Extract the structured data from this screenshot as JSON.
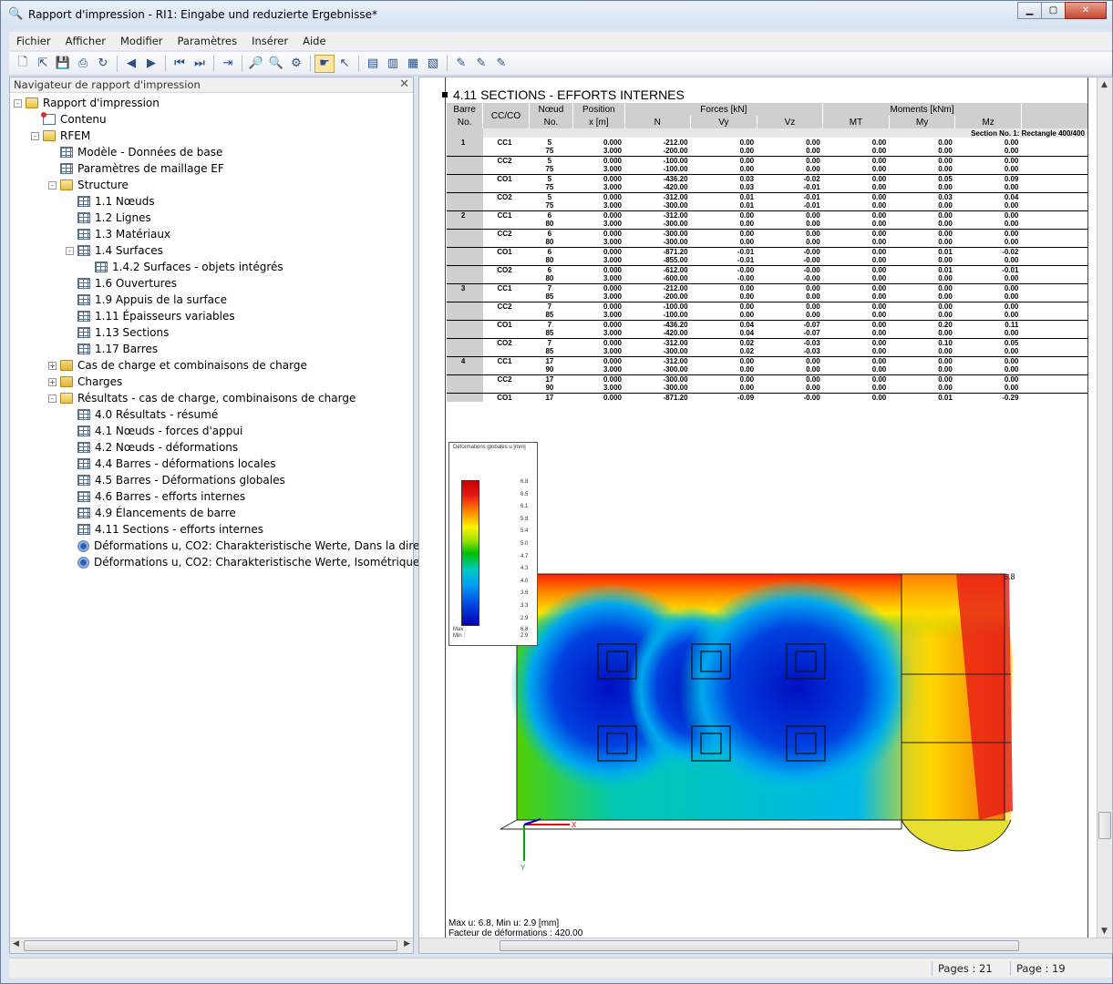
{
  "window": {
    "title": "Rapport d'impression - RI1: Eingabe und reduzierte Ergebnisse*"
  },
  "menu": [
    "Fichier",
    "Afficher",
    "Modifier",
    "Paramètres",
    "Insérer",
    "Aide"
  ],
  "navigator": {
    "header": "Navigateur de rapport d'impression",
    "items": [
      {
        "label": "Rapport d'impression",
        "level": 0,
        "icon": "folder-open",
        "exp": "-"
      },
      {
        "label": "Contenu",
        "level": 1,
        "icon": "contents",
        "exp": ""
      },
      {
        "label": "RFEM",
        "level": 1,
        "icon": "folder-open",
        "exp": "-"
      },
      {
        "label": "Modèle - Données de base",
        "level": 2,
        "icon": "table",
        "exp": ""
      },
      {
        "label": "Paramètres de maillage EF",
        "level": 2,
        "icon": "table",
        "exp": ""
      },
      {
        "label": "Structure",
        "level": 2,
        "icon": "folder-open",
        "exp": "-"
      },
      {
        "label": "1.1 Nœuds",
        "level": 3,
        "icon": "table",
        "exp": ""
      },
      {
        "label": "1.2 Lignes",
        "level": 3,
        "icon": "table",
        "exp": ""
      },
      {
        "label": "1.3 Matériaux",
        "level": 3,
        "icon": "table",
        "exp": ""
      },
      {
        "label": "1.4 Surfaces",
        "level": 3,
        "icon": "table",
        "exp": "-"
      },
      {
        "label": "1.4.2 Surfaces - objets intégrés",
        "level": 4,
        "icon": "table",
        "exp": ""
      },
      {
        "label": "1.6 Ouvertures",
        "level": 3,
        "icon": "table",
        "exp": ""
      },
      {
        "label": "1.9 Appuis de la surface",
        "level": 3,
        "icon": "table",
        "exp": ""
      },
      {
        "label": "1.11 Épaisseurs variables",
        "level": 3,
        "icon": "table",
        "exp": ""
      },
      {
        "label": "1.13 Sections",
        "level": 3,
        "icon": "table",
        "exp": ""
      },
      {
        "label": "1.17 Barres",
        "level": 3,
        "icon": "table",
        "exp": ""
      },
      {
        "label": "Cas de charge et combinaisons de charge",
        "level": 2,
        "icon": "folder",
        "exp": "+"
      },
      {
        "label": "Charges",
        "level": 2,
        "icon": "folder",
        "exp": "+"
      },
      {
        "label": "Résultats - cas de charge, combinaisons de charge",
        "level": 2,
        "icon": "folder-open",
        "exp": "-"
      },
      {
        "label": "4.0 Résultats - résumé",
        "level": 3,
        "icon": "table",
        "exp": ""
      },
      {
        "label": "4.1 Nœuds - forces d'appui",
        "level": 3,
        "icon": "table",
        "exp": ""
      },
      {
        "label": "4.2 Nœuds - déformations",
        "level": 3,
        "icon": "table",
        "exp": ""
      },
      {
        "label": "4.4 Barres - déformations locales",
        "level": 3,
        "icon": "table",
        "exp": ""
      },
      {
        "label": "4.5 Barres - Déformations globales",
        "level": 3,
        "icon": "table",
        "exp": ""
      },
      {
        "label": "4.6 Barres - efforts internes",
        "level": 3,
        "icon": "table",
        "exp": ""
      },
      {
        "label": "4.9 Élancements de barre",
        "level": 3,
        "icon": "table",
        "exp": ""
      },
      {
        "label": "4.11 Sections - efforts internes",
        "level": 3,
        "icon": "table",
        "exp": ""
      },
      {
        "label": "Déformations u, CO2: Charakteristische Werte, Dans la direction Z",
        "level": 3,
        "icon": "eye",
        "exp": ""
      },
      {
        "label": "Déformations u, CO2: Charakteristische Werte, Isométrique",
        "level": 3,
        "icon": "eye",
        "exp": ""
      }
    ]
  },
  "report": {
    "section_title": "4.11 SECTIONS - EFFORTS INTERNES",
    "headers": {
      "barre": "Barre",
      "barre_no": "No.",
      "cc": "CC/CO",
      "noeud": "Nœud",
      "noeud_no": "No.",
      "position": "Position",
      "position_unit": "x [m]",
      "forces": "Forces [kN]",
      "moments": "Moments [kNm]",
      "n": "N",
      "vy": "Vy",
      "vz": "Vz",
      "mt": "MT",
      "my": "My",
      "mz": "Mz"
    },
    "section_label": "Section No. 1: Rectangle 400/400",
    "rows": [
      [
        "1",
        "CC1",
        "5",
        "0.000",
        "-212.00",
        "0.00",
        "0.00",
        "0.00",
        "0.00",
        "0.00"
      ],
      [
        "",
        "",
        "75",
        "3.000",
        "-200.00",
        "0.00",
        "0.00",
        "0.00",
        "0.00",
        "0.00"
      ],
      [
        "",
        "CC2",
        "5",
        "0.000",
        "-100.00",
        "0.00",
        "0.00",
        "0.00",
        "0.00",
        "0.00"
      ],
      [
        "",
        "",
        "75",
        "3.000",
        "-100.00",
        "0.00",
        "0.00",
        "0.00",
        "0.00",
        "0.00"
      ],
      [
        "",
        "CO1",
        "5",
        "0.000",
        "-436.20",
        "0.03",
        "-0.02",
        "0.00",
        "0.05",
        "0.09"
      ],
      [
        "",
        "",
        "75",
        "3.000",
        "-420.00",
        "0.03",
        "-0.01",
        "0.00",
        "0.00",
        "0.00"
      ],
      [
        "",
        "CO2",
        "5",
        "0.000",
        "-312.00",
        "0.01",
        "-0.01",
        "0.00",
        "0.03",
        "0.04"
      ],
      [
        "",
        "",
        "75",
        "3.000",
        "-300.00",
        "0.01",
        "-0.01",
        "0.00",
        "0.00",
        "0.00"
      ],
      [
        "2",
        "CC1",
        "6",
        "0.000",
        "-312.00",
        "0.00",
        "0.00",
        "0.00",
        "0.00",
        "0.00"
      ],
      [
        "",
        "",
        "80",
        "3.000",
        "-300.00",
        "0.00",
        "0.00",
        "0.00",
        "0.00",
        "0.00"
      ],
      [
        "",
        "CC2",
        "6",
        "0.000",
        "-300.00",
        "0.00",
        "0.00",
        "0.00",
        "0.00",
        "0.00"
      ],
      [
        "",
        "",
        "80",
        "3.000",
        "-300.00",
        "0.00",
        "0.00",
        "0.00",
        "0.00",
        "0.00"
      ],
      [
        "",
        "CO1",
        "6",
        "0.000",
        "-871.20",
        "-0.01",
        "-0.00",
        "0.00",
        "0.01",
        "-0.02"
      ],
      [
        "",
        "",
        "80",
        "3.000",
        "-855.00",
        "-0.01",
        "-0.00",
        "0.00",
        "0.00",
        "0.00"
      ],
      [
        "",
        "CO2",
        "6",
        "0.000",
        "-612.00",
        "-0.00",
        "-0.00",
        "0.00",
        "0.01",
        "-0.01"
      ],
      [
        "",
        "",
        "80",
        "3.000",
        "-600.00",
        "-0.00",
        "-0.00",
        "0.00",
        "0.00",
        "0.00"
      ],
      [
        "3",
        "CC1",
        "7",
        "0.000",
        "-212.00",
        "0.00",
        "0.00",
        "0.00",
        "0.00",
        "0.00"
      ],
      [
        "",
        "",
        "85",
        "3.000",
        "-200.00",
        "0.00",
        "0.00",
        "0.00",
        "0.00",
        "0.00"
      ],
      [
        "",
        "CC2",
        "7",
        "0.000",
        "-100.00",
        "0.00",
        "0.00",
        "0.00",
        "0.00",
        "0.00"
      ],
      [
        "",
        "",
        "85",
        "3.000",
        "-100.00",
        "0.00",
        "0.00",
        "0.00",
        "0.00",
        "0.00"
      ],
      [
        "",
        "CO1",
        "7",
        "0.000",
        "-436.20",
        "0.04",
        "-0.07",
        "0.00",
        "0.20",
        "0.11"
      ],
      [
        "",
        "",
        "85",
        "3.000",
        "-420.00",
        "0.04",
        "-0.07",
        "0.00",
        "0.00",
        "0.00"
      ],
      [
        "",
        "CO2",
        "7",
        "0.000",
        "-312.00",
        "0.02",
        "-0.03",
        "0.00",
        "0.10",
        "0.05"
      ],
      [
        "",
        "",
        "85",
        "3.000",
        "-300.00",
        "0.02",
        "-0.03",
        "0.00",
        "0.00",
        "0.00"
      ],
      [
        "4",
        "CC1",
        "17",
        "0.000",
        "-312.00",
        "0.00",
        "0.00",
        "0.00",
        "0.00",
        "0.00"
      ],
      [
        "",
        "",
        "90",
        "3.000",
        "-300.00",
        "0.00",
        "0.00",
        "0.00",
        "0.00",
        "0.00"
      ],
      [
        "",
        "CC2",
        "17",
        "0.000",
        "-300.00",
        "0.00",
        "0.00",
        "0.00",
        "0.00",
        "0.00"
      ],
      [
        "",
        "",
        "90",
        "3.000",
        "-300.00",
        "0.00",
        "0.00",
        "0.00",
        "0.00",
        "0.00"
      ],
      [
        "",
        "CO1",
        "17",
        "0.000",
        "-871.20",
        "-0.09",
        "-0.00",
        "0.00",
        "0.01",
        "-0.29"
      ]
    ],
    "legend": {
      "title": "Déformations globales u [mm]",
      "ticks": [
        "6.8",
        "6.5",
        "6.1",
        "5.8",
        "5.4",
        "5.0",
        "4.7",
        "4.3",
        "4.0",
        "3.6",
        "3.3",
        "2.9"
      ],
      "max_label": "Max :",
      "max": "6.8",
      "min_label": "Min :",
      "min": "2.9"
    },
    "figure_label_max": "6.8",
    "axis_x": "X",
    "axis_y": "Y",
    "caption_1": "Max u: 6.8, Min u: 2.9 [mm]",
    "caption_2": "Facteur de déformations : 420.00"
  },
  "status": {
    "pages": "Pages : 21",
    "page": "Page : 19"
  },
  "colors": {
    "accent": "#3b67b4",
    "header_gray": "#cfcfcf"
  }
}
